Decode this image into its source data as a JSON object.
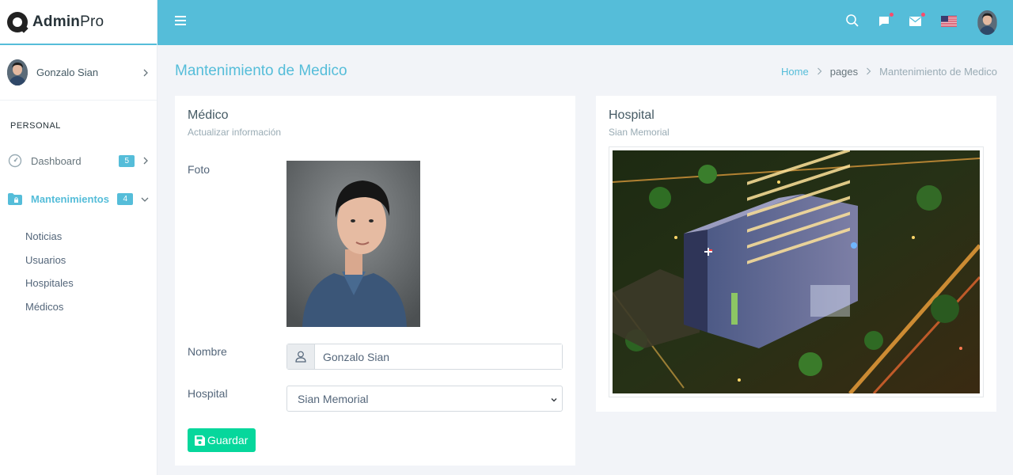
{
  "brand": {
    "name_bold": "Admin",
    "name_light": "Pro"
  },
  "user": {
    "name": "Gonzalo Sian"
  },
  "sidebar": {
    "caption": "PERSONAL",
    "items": [
      {
        "label": "Dashboard",
        "badge": "5"
      },
      {
        "label": "Mantenimientos",
        "badge": "4"
      }
    ],
    "subitems": [
      "Noticias",
      "Usuarios",
      "Hospitales",
      "Médicos"
    ]
  },
  "page": {
    "title": "Mantenimiento de Medico"
  },
  "breadcrumb": {
    "home": "Home",
    "middle": "pages",
    "current": "Mantenimiento de Medico"
  },
  "medico_card": {
    "title": "Médico",
    "subtitle": "Actualizar información",
    "foto_label": "Foto",
    "nombre_label": "Nombre",
    "nombre_value": "Gonzalo Sian",
    "hospital_label": "Hospital",
    "hospital_selected": "Sian Memorial",
    "save_label": "Guardar"
  },
  "hospital_card": {
    "title": "Hospital",
    "subtitle": "Sian Memorial"
  },
  "colors": {
    "accent": "#55bdd9",
    "success": "#06d79c",
    "notify": "#fc4b6c"
  }
}
